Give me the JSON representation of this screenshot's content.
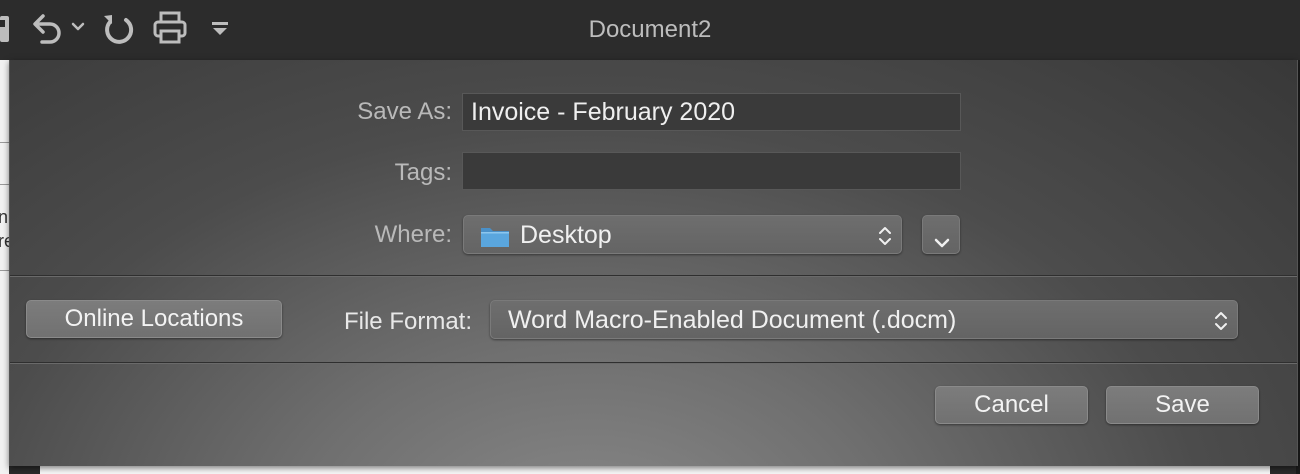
{
  "window": {
    "title": "Document2"
  },
  "toolbar": {
    "icons": [
      "save-icon",
      "undo-icon",
      "undo-dropdown-icon",
      "redo-icon",
      "print-icon",
      "customize-toolbar-icon"
    ]
  },
  "background_fragments": {
    "line1": "n",
    "line2": "re"
  },
  "dialog": {
    "save_as_label": "Save As:",
    "save_as_value": "Invoice - February 2020",
    "tags_label": "Tags:",
    "tags_value": "",
    "where_label": "Where:",
    "where_value": "Desktop",
    "online_locations_label": "Online Locations",
    "file_format_label": "File Format:",
    "file_format_value": "Word Macro-Enabled Document (.docm)",
    "cancel_label": "Cancel",
    "save_label": "Save"
  },
  "colors": {
    "folder": "#5aa6de",
    "sheet_dark": "#383838",
    "sheet_light": "#8a8a8a"
  }
}
